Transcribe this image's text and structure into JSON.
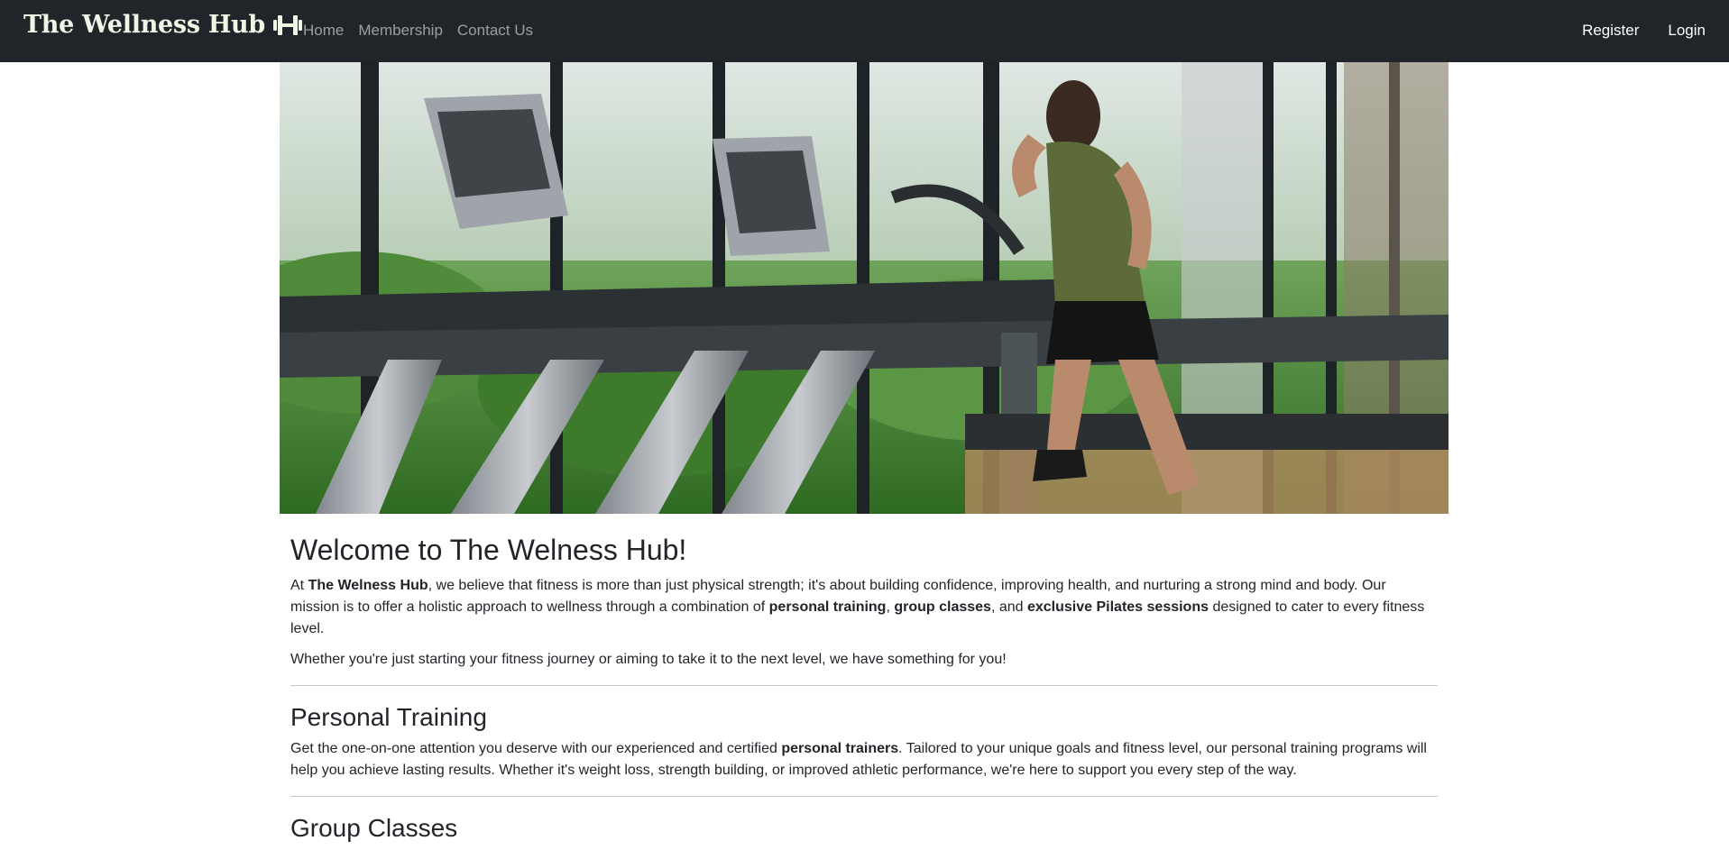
{
  "navbar": {
    "brand": "The Wellness Hub",
    "brand_icon": "dumbbell-icon",
    "links": [
      {
        "label": "Home"
      },
      {
        "label": "Membership"
      },
      {
        "label": "Contact Us"
      }
    ],
    "right_links": [
      {
        "label": "Register"
      },
      {
        "label": "Login"
      }
    ],
    "colors": {
      "background": "#212529",
      "brand": "#eef6e6"
    }
  },
  "hero": {
    "image": "gym-treadmill-runner-photo"
  },
  "welcome": {
    "title": "Welcome to The Welness Hub!",
    "p1": {
      "t1": "At ",
      "b1": "The Welness Hub",
      "t2": ", we believe that fitness is more than just physical strength; it's about building confidence, improving health, and nurturing a strong mind and body. Our mission is to offer a holistic approach to wellness through a combination of ",
      "b2": "personal training",
      "t3": ", ",
      "b3": "group classes",
      "t4": ", and ",
      "b4": "exclusive Pilates sessions",
      "t5": " designed to cater to every fitness level."
    },
    "p2": "Whether you're just starting your fitness journey or aiming to take it to the next level, we have something for you!"
  },
  "personal_training": {
    "title": "Personal Training",
    "p": {
      "t1": "Get the one-on-one attention you deserve with our experienced and certified ",
      "b1": "personal trainers",
      "t2": ". Tailored to your unique goals and fitness level, our personal training programs will help you achieve lasting results. Whether it's weight loss, strength building, or improved athletic performance, we're here to support you every step of the way."
    }
  },
  "group_classes": {
    "title": "Group Classes"
  }
}
